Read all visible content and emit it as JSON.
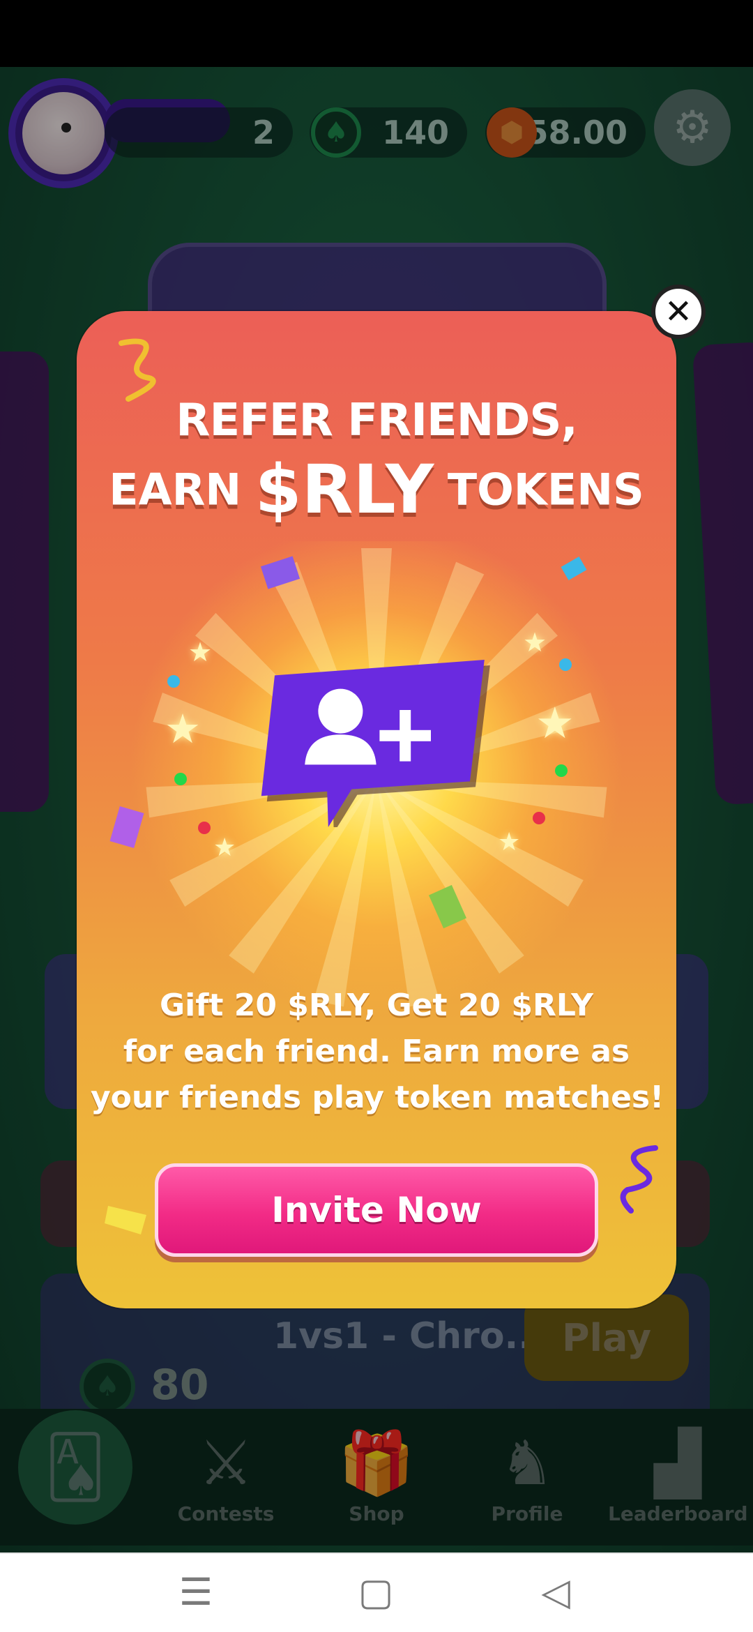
{
  "hud": {
    "level": "2",
    "spades": "140",
    "tokens": "58.00"
  },
  "background": {
    "match_title": "1vs1 - Chro...",
    "play_label": "Play",
    "entry_fee": "80"
  },
  "nav": {
    "items": [
      {
        "label": "Contests",
        "icon": "swords-icon"
      },
      {
        "label": "Shop",
        "icon": "gift-icon"
      },
      {
        "label": "Profile",
        "icon": "profile-icon"
      },
      {
        "label": "Leaderboard",
        "icon": "podium-icon"
      }
    ],
    "home_icon": "cards-icon"
  },
  "popup": {
    "headline_line1": "REFER FRIENDS,",
    "headline_earn": "EARN",
    "headline_token": "$RLY",
    "headline_tokens": "TOKENS",
    "description": [
      "Gift 20 $RLY, Get 20 $RLY",
      "for each friend. Earn more as",
      "your friends play token matches!"
    ],
    "invite_label": "Invite Now",
    "close_label": "✕"
  },
  "colors": {
    "popup_top": "#ec5f57",
    "popup_bottom": "#eec238",
    "invite_button": "#f22b86",
    "bubble": "#6a2ae0"
  }
}
